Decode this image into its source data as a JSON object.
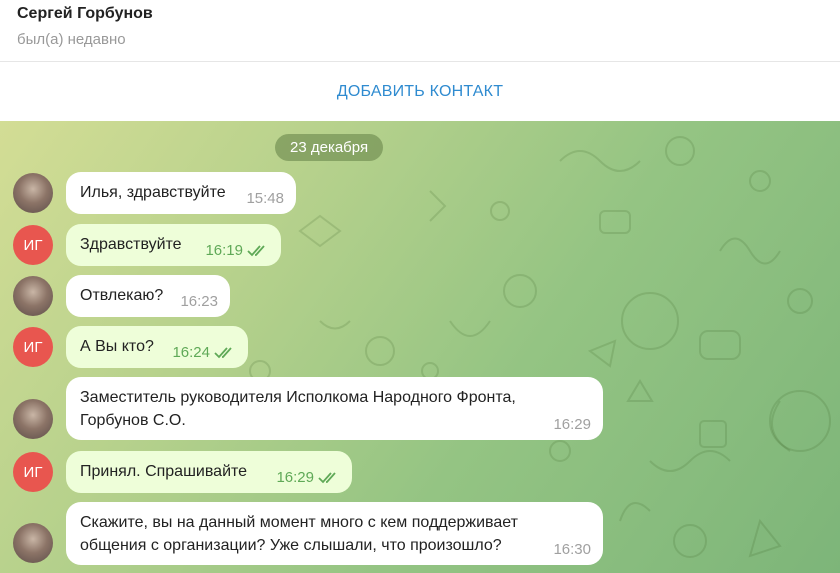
{
  "header": {
    "contact_name": "Сергей Горбунов",
    "status": "был(а) недавно",
    "add_contact_label": "ДОБАВИТЬ КОНТАКТ"
  },
  "chat": {
    "date_label": "23 декабря",
    "incoming_color": "#ffffff",
    "outgoing_color": "#eefed9",
    "messages": [
      {
        "direction": "in",
        "avatar": "photo",
        "text": "Илья, здравствуйте",
        "time": "15:48"
      },
      {
        "direction": "out",
        "avatar": "ИГ",
        "text": "Здравствуйте",
        "time": "16:19",
        "read": true
      },
      {
        "direction": "in",
        "avatar": "photo",
        "text": "Отвлекаю?",
        "time": "16:23"
      },
      {
        "direction": "out",
        "avatar": "ИГ",
        "text": "А Вы кто?",
        "time": "16:24",
        "read": true
      },
      {
        "direction": "in",
        "avatar": "photo",
        "line1": "Заместитель руководителя Исполкома Народного Фронта,",
        "line2": "Горбунов С.О.",
        "time": "16:29"
      },
      {
        "direction": "out",
        "avatar": "ИГ",
        "text": "Принял. Спрашивайте",
        "time": "16:29",
        "read": true
      },
      {
        "direction": "in",
        "avatar": "photo",
        "line1": "Скажите, вы на данный момент много с кем поддерживает",
        "line2": "общения с организации? Уже слышали, что произошло?",
        "time": "16:30"
      }
    ]
  }
}
